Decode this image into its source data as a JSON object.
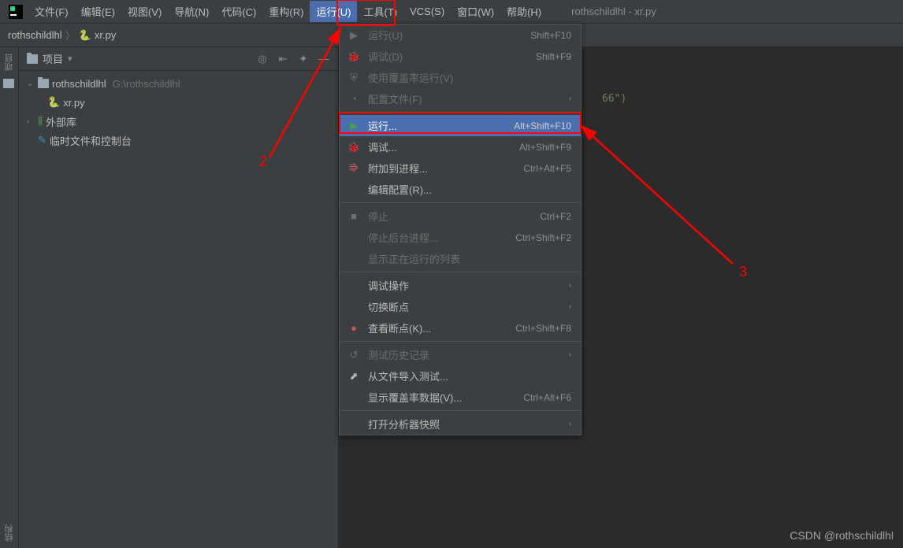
{
  "window_title": "rothschildlhl - xr.py",
  "menubar": {
    "file": "文件(F)",
    "edit": "编辑(E)",
    "view": "视图(V)",
    "navigate": "导航(N)",
    "code": "代码(C)",
    "refactor": "重构(R)",
    "run": "运行(U)",
    "tools": "工具(T)",
    "vcs": "VCS(S)",
    "window": "窗口(W)",
    "help": "帮助(H)"
  },
  "breadcrumb": {
    "root": "rothschildlhl",
    "file": "xr.py"
  },
  "sidebar": {
    "title": "项目",
    "root_name": "rothschildlhl",
    "root_path": "G:\\rothschildlhl",
    "file1": "xr.py",
    "external_libs": "外部库",
    "scratches": "临时文件和控制台"
  },
  "gutter": {
    "project_label": "项目",
    "structure_label": "结构"
  },
  "dropdown": {
    "run_u": "运行(U)",
    "run_u_sc": "Shift+F10",
    "debug_d": "调试(D)",
    "debug_d_sc": "Shift+F9",
    "run_coverage": "使用覆盖率运行(V)",
    "profile": "配置文件(F)",
    "run_dots": "运行...",
    "run_dots_sc": "Alt+Shift+F10",
    "debug_dots": "调试...",
    "debug_dots_sc": "Alt+Shift+F9",
    "attach": "附加到进程...",
    "attach_sc": "Ctrl+Alt+F5",
    "edit_config": "编辑配置(R)...",
    "stop": "停止",
    "stop_sc": "Ctrl+F2",
    "stop_bg": "停止后台进程...",
    "stop_bg_sc": "Ctrl+Shift+F2",
    "show_running": "显示正在运行的列表",
    "debug_actions": "调试操作",
    "toggle_bp": "切换断点",
    "view_bp": "查看断点(K)...",
    "view_bp_sc": "Ctrl+Shift+F8",
    "test_history": "测试历史记录",
    "import_tests": "从文件导入测试...",
    "show_coverage": "显示覆盖率数据(V)...",
    "show_coverage_sc": "Ctrl+Alt+F6",
    "profiler_snapshot": "打开分析器快照"
  },
  "code": {
    "fragment": "66\")"
  },
  "annotations": {
    "label2": "2",
    "label3": "3"
  },
  "watermark": "CSDN @rothschildlhl"
}
